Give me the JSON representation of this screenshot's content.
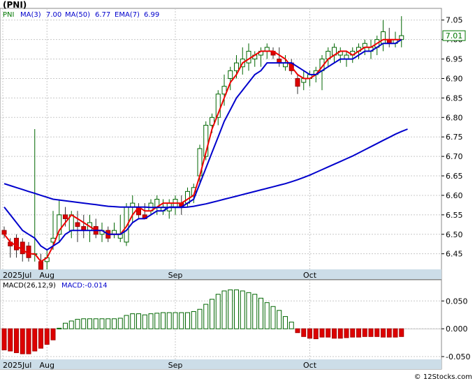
{
  "chart_data": [
    {
      "type": "candlestick",
      "title": "(PNI)",
      "legend": {
        "ticker": "PNI",
        "ma3_label": "MA(3)",
        "ma3_value": "7.00",
        "ma50_label": "MA(50)",
        "ma50_value": "6.77",
        "ema7_label": "EMA(7)",
        "ema7_value": "6.99"
      },
      "last_price_label": "7.01",
      "ylim": [
        6.41,
        7.08
      ],
      "y_ticks": [
        "7.05",
        "7.00",
        "6.95",
        "6.90",
        "6.85",
        "6.80",
        "6.75",
        "6.70",
        "6.65",
        "6.60",
        "6.55",
        "6.50",
        "6.45"
      ],
      "x_labels": [
        {
          "label": "2025Jul",
          "index": 0
        },
        {
          "label": "Aug",
          "index": 7
        },
        {
          "label": "Sep",
          "index": 28
        },
        {
          "label": "Oct",
          "index": 50
        }
      ],
      "candles": [
        [
          6.51,
          6.52,
          6.49,
          6.5
        ],
        [
          6.48,
          6.49,
          6.44,
          6.47
        ],
        [
          6.49,
          6.5,
          6.44,
          6.46
        ],
        [
          6.48,
          6.49,
          6.43,
          6.45
        ],
        [
          6.47,
          6.48,
          6.43,
          6.44
        ],
        [
          6.45,
          6.77,
          6.43,
          6.45
        ],
        [
          6.43,
          6.45,
          6.41,
          6.41
        ],
        [
          6.43,
          6.46,
          6.41,
          6.44
        ],
        [
          6.48,
          6.56,
          6.46,
          6.49
        ],
        [
          6.5,
          6.59,
          6.48,
          6.55
        ],
        [
          6.55,
          6.57,
          6.52,
          6.54
        ],
        [
          6.51,
          6.56,
          6.49,
          6.55
        ],
        [
          6.53,
          6.56,
          6.48,
          6.52
        ],
        [
          6.52,
          6.55,
          6.49,
          6.51
        ],
        [
          6.51,
          6.55,
          6.48,
          6.53
        ],
        [
          6.52,
          6.54,
          6.49,
          6.5
        ],
        [
          6.5,
          6.53,
          6.48,
          6.51
        ],
        [
          6.51,
          6.52,
          6.48,
          6.49
        ],
        [
          6.5,
          6.53,
          6.49,
          6.51
        ],
        [
          6.49,
          6.55,
          6.48,
          6.5
        ],
        [
          6.48,
          6.58,
          6.47,
          6.57
        ],
        [
          6.57,
          6.6,
          6.53,
          6.58
        ],
        [
          6.57,
          6.58,
          6.54,
          6.55
        ],
        [
          6.55,
          6.58,
          6.54,
          6.54
        ],
        [
          6.56,
          6.59,
          6.55,
          6.58
        ],
        [
          6.57,
          6.6,
          6.55,
          6.59
        ],
        [
          6.56,
          6.59,
          6.55,
          6.57
        ],
        [
          6.56,
          6.59,
          6.54,
          6.58
        ],
        [
          6.57,
          6.6,
          6.55,
          6.59
        ],
        [
          6.58,
          6.6,
          6.55,
          6.57
        ],
        [
          6.58,
          6.62,
          6.57,
          6.61
        ],
        [
          6.6,
          6.63,
          6.58,
          6.62
        ],
        [
          6.65,
          6.73,
          6.63,
          6.72
        ],
        [
          6.7,
          6.79,
          6.69,
          6.78
        ],
        [
          6.78,
          6.81,
          6.76,
          6.8
        ],
        [
          6.8,
          6.87,
          6.78,
          6.86
        ],
        [
          6.86,
          6.91,
          6.83,
          6.88
        ],
        [
          6.9,
          6.93,
          6.87,
          6.92
        ],
        [
          6.92,
          6.96,
          6.9,
          6.94
        ],
        [
          6.93,
          6.98,
          6.91,
          6.95
        ],
        [
          6.94,
          6.99,
          6.92,
          6.97
        ],
        [
          6.95,
          6.97,
          6.93,
          6.96
        ],
        [
          6.96,
          6.98,
          6.93,
          6.97
        ],
        [
          6.97,
          6.99,
          6.95,
          6.98
        ],
        [
          6.97,
          6.98,
          6.95,
          6.96
        ],
        [
          6.95,
          6.98,
          6.93,
          6.94
        ],
        [
          6.93,
          6.96,
          6.92,
          6.94
        ],
        [
          6.94,
          6.95,
          6.91,
          6.92
        ],
        [
          6.9,
          6.91,
          6.86,
          6.88
        ],
        [
          6.89,
          6.92,
          6.87,
          6.9
        ],
        [
          6.9,
          6.92,
          6.88,
          6.91
        ],
        [
          6.91,
          6.93,
          6.89,
          6.92
        ],
        [
          6.92,
          6.96,
          6.87,
          6.95
        ],
        [
          6.95,
          6.98,
          6.93,
          6.97
        ],
        [
          6.96,
          6.99,
          6.94,
          6.98
        ],
        [
          6.96,
          6.98,
          6.94,
          6.97
        ],
        [
          6.95,
          6.97,
          6.93,
          6.96
        ],
        [
          6.96,
          6.98,
          6.94,
          6.97
        ],
        [
          6.97,
          6.99,
          6.95,
          6.98
        ],
        [
          6.98,
          7.0,
          6.96,
          6.99
        ],
        [
          6.97,
          7.0,
          6.95,
          6.98
        ],
        [
          6.98,
          7.01,
          6.96,
          7.0
        ],
        [
          6.99,
          7.05,
          6.97,
          7.02
        ],
        [
          7.0,
          7.03,
          6.98,
          6.99
        ],
        [
          6.99,
          7.02,
          6.98,
          7.0
        ],
        [
          7.0,
          7.06,
          6.98,
          7.01
        ]
      ],
      "series": [
        {
          "name": "MA(3)",
          "color": "#ee0000",
          "values": [
            6.5,
            6.48,
            6.47,
            6.46,
            6.45,
            6.45,
            6.43,
            6.44,
            6.47,
            6.51,
            6.53,
            6.55,
            6.54,
            6.53,
            6.52,
            6.51,
            6.51,
            6.5,
            6.5,
            6.5,
            6.52,
            6.55,
            6.57,
            6.56,
            6.56,
            6.57,
            6.58,
            6.58,
            6.58,
            6.58,
            6.59,
            6.6,
            6.65,
            6.71,
            6.77,
            6.81,
            6.85,
            6.89,
            6.91,
            6.94,
            6.95,
            6.96,
            6.97,
            6.97,
            6.97,
            6.96,
            6.95,
            6.93,
            6.91,
            6.9,
            6.9,
            6.91,
            6.93,
            6.95,
            6.96,
            6.97,
            6.97,
            6.96,
            6.97,
            6.98,
            6.98,
            6.99,
            7.0,
            7.0,
            7.0,
            7.0
          ]
        },
        {
          "name": "MA(50)",
          "color": "#0000cc",
          "values": [
            6.63,
            6.625,
            6.62,
            6.615,
            6.61,
            6.605,
            6.6,
            6.595,
            6.59,
            6.588,
            6.586,
            6.584,
            6.582,
            6.58,
            6.578,
            6.576,
            6.574,
            6.572,
            6.571,
            6.57,
            6.57,
            6.57,
            6.57,
            6.57,
            6.569,
            6.569,
            6.569,
            6.569,
            6.569,
            6.569,
            6.57,
            6.572,
            6.575,
            6.578,
            6.582,
            6.586,
            6.59,
            6.594,
            6.598,
            6.602,
            6.606,
            6.61,
            6.614,
            6.618,
            6.622,
            6.626,
            6.63,
            6.635,
            6.64,
            6.646,
            6.652,
            6.659,
            6.666,
            6.673,
            6.68,
            6.687,
            6.694,
            6.701,
            6.709,
            6.717,
            6.725,
            6.733,
            6.741,
            6.749,
            6.757,
            6.764,
            6.77
          ]
        },
        {
          "name": "EMA(7)",
          "color": "#0000cc",
          "values": [
            6.57,
            6.55,
            6.53,
            6.51,
            6.5,
            6.49,
            6.47,
            6.46,
            6.47,
            6.48,
            6.5,
            6.51,
            6.51,
            6.51,
            6.51,
            6.51,
            6.51,
            6.5,
            6.5,
            6.5,
            6.51,
            6.53,
            6.54,
            6.54,
            6.55,
            6.56,
            6.56,
            6.57,
            6.57,
            6.57,
            6.58,
            6.59,
            6.63,
            6.67,
            6.71,
            6.75,
            6.79,
            6.82,
            6.85,
            6.87,
            6.89,
            6.91,
            6.92,
            6.94,
            6.94,
            6.94,
            6.94,
            6.94,
            6.93,
            6.92,
            6.91,
            6.91,
            6.92,
            6.93,
            6.94,
            6.95,
            6.95,
            6.95,
            6.96,
            6.97,
            6.97,
            6.98,
            6.99,
            6.99,
            6.99,
            7.0
          ]
        }
      ]
    },
    {
      "type": "bar",
      "title": "MACD(26,12,9)",
      "value_label": "MACD:-0.014",
      "ylim": [
        -0.055,
        0.088
      ],
      "y_ticks": [
        "0.050",
        "0.000",
        "-0.050"
      ],
      "x_labels": [
        {
          "label": "2025Jul",
          "index": 0
        },
        {
          "label": "Aug",
          "index": 7
        },
        {
          "label": "Sep",
          "index": 28
        },
        {
          "label": "Oct",
          "index": 50
        }
      ],
      "values": [
        -0.038,
        -0.04,
        -0.043,
        -0.045,
        -0.045,
        -0.04,
        -0.035,
        -0.028,
        -0.02,
        0.001,
        0.01,
        0.014,
        0.017,
        0.018,
        0.018,
        0.018,
        0.018,
        0.018,
        0.018,
        0.019,
        0.024,
        0.027,
        0.027,
        0.025,
        0.027,
        0.028,
        0.029,
        0.029,
        0.029,
        0.029,
        0.029,
        0.031,
        0.035,
        0.044,
        0.053,
        0.062,
        0.068,
        0.07,
        0.07,
        0.068,
        0.065,
        0.062,
        0.055,
        0.047,
        0.04,
        0.033,
        0.022,
        0.012,
        -0.007,
        -0.014,
        -0.017,
        -0.018,
        -0.015,
        -0.015,
        -0.017,
        -0.017,
        -0.016,
        -0.015,
        -0.015,
        -0.014,
        -0.014,
        -0.014,
        -0.015,
        -0.015,
        -0.015,
        -0.014
      ]
    }
  ],
  "copyright": "© 12Stocks.com"
}
